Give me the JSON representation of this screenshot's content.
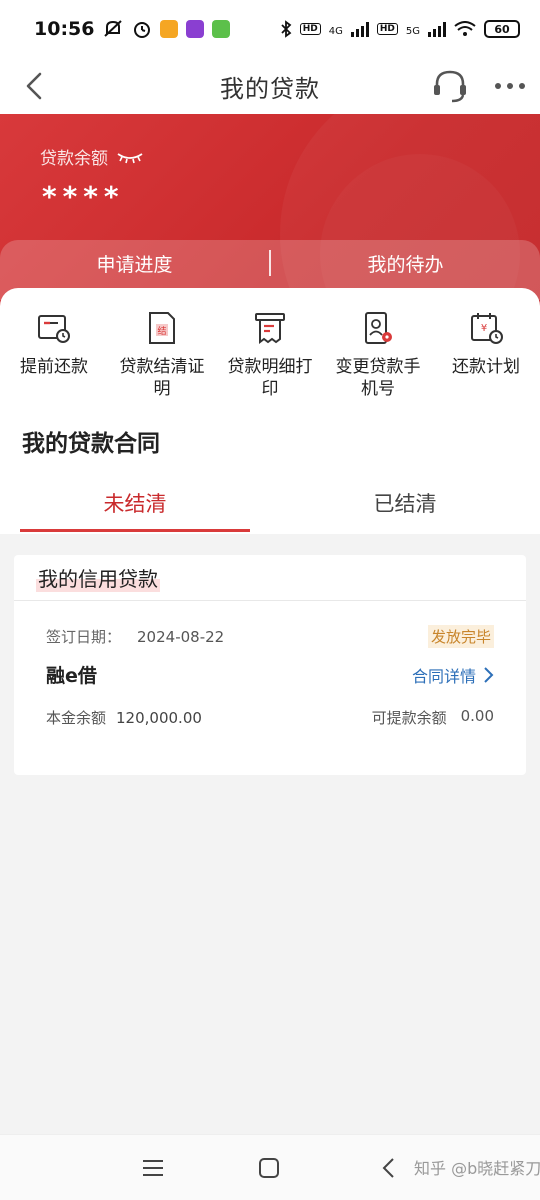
{
  "status_bar": {
    "time": "10:56",
    "signal1_label": "4G",
    "signal2_label": "5G",
    "hd": "HD",
    "battery": "60"
  },
  "header": {
    "title": "我的贷款"
  },
  "balance": {
    "label": "贷款余额",
    "masked_value": "****"
  },
  "top_tabs": [
    {
      "label": "申请进度"
    },
    {
      "label": "我的待办"
    }
  ],
  "quick_actions": [
    {
      "label": "提前还款",
      "icon": "early-repay-icon"
    },
    {
      "label": "贷款结清证明",
      "icon": "settlement-certificate-icon"
    },
    {
      "label": "贷款明细打印",
      "icon": "print-detail-icon"
    },
    {
      "label": "变更贷款手机号",
      "icon": "change-phone-icon"
    },
    {
      "label": "还款计划",
      "icon": "repayment-plan-icon"
    }
  ],
  "contracts": {
    "title": "我的贷款合同",
    "tabs": [
      {
        "label": "未结清",
        "active": true
      },
      {
        "label": "已结清",
        "active": false
      }
    ]
  },
  "loan_card": {
    "category": "我的信用贷款",
    "sign_date_label": "签订日期：",
    "sign_date": "2024-08-22",
    "status": "发放完毕",
    "product_name": "融e借",
    "detail_link": "合同详情",
    "principal_label": "本金余额",
    "principal_value": "120,000.00",
    "withdrawable_label": "可提款余额",
    "withdrawable_value": "0.00"
  },
  "watermark": "知乎 @b晓赶紧刀笔",
  "colors": {
    "brand_red": "#c92a2c",
    "link_blue": "#2d6fb8",
    "badge_text": "#c8852b",
    "badge_bg": "#fbefdc"
  }
}
